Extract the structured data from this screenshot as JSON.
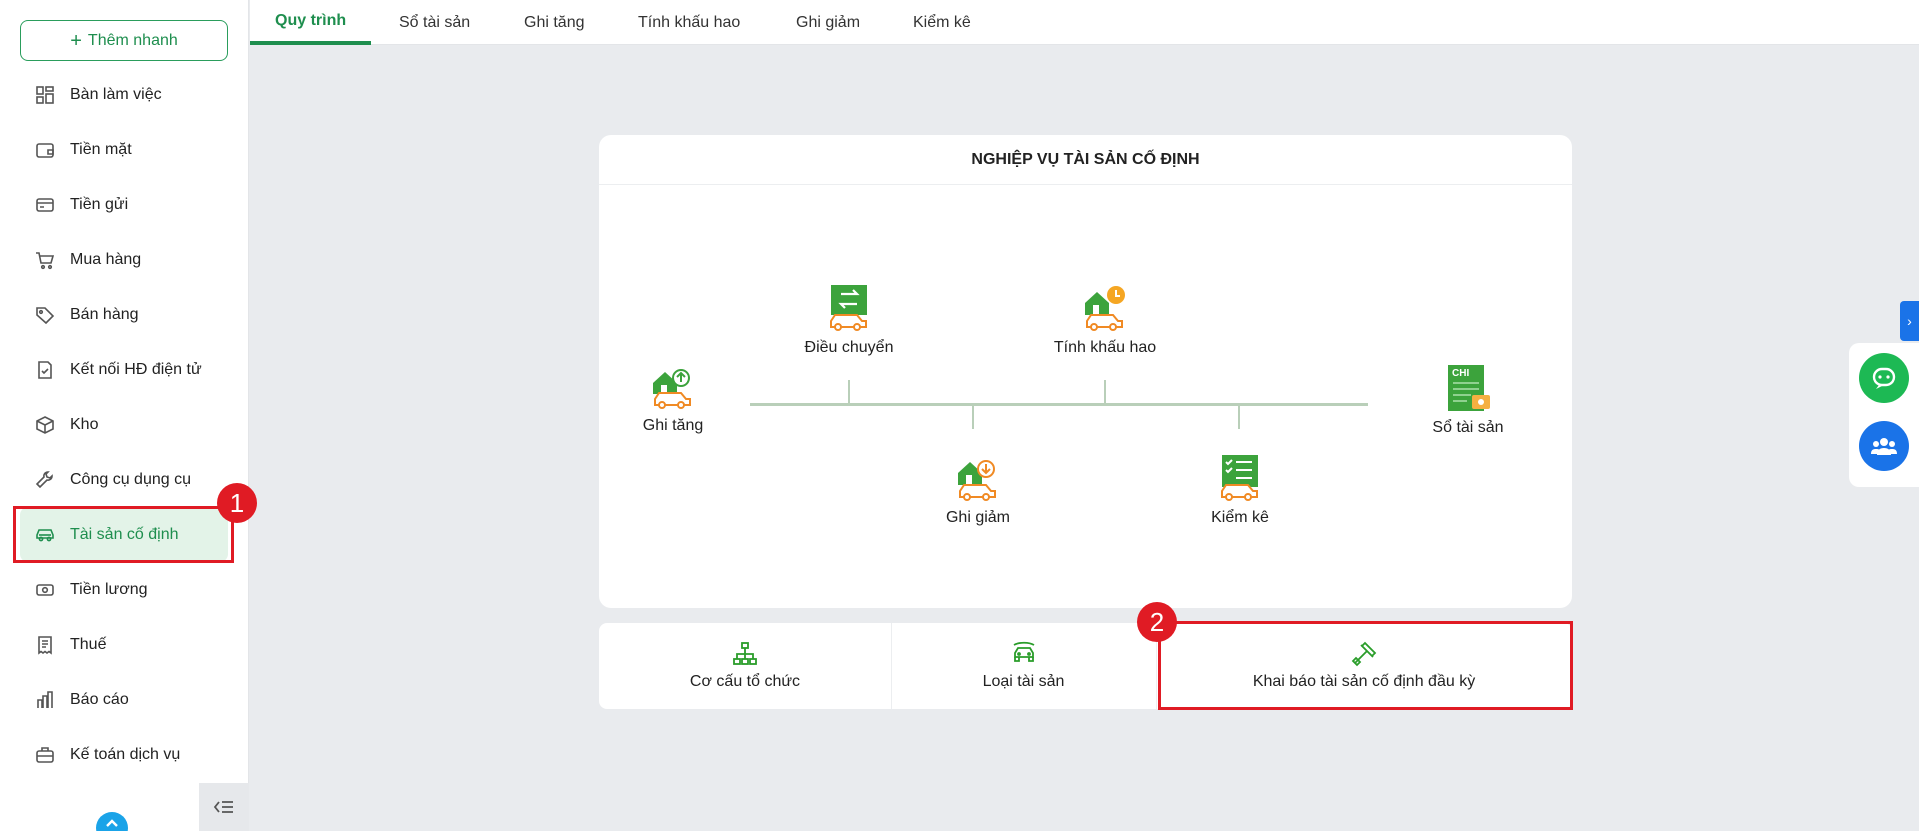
{
  "sidebar": {
    "quick_add_label": "Thêm nhanh",
    "items": [
      {
        "label": "Bàn làm việc",
        "icon": "dashboard-icon"
      },
      {
        "label": "Tiền mặt",
        "icon": "wallet-icon"
      },
      {
        "label": "Tiền gửi",
        "icon": "card-icon"
      },
      {
        "label": "Mua hàng",
        "icon": "cart-icon"
      },
      {
        "label": "Bán hàng",
        "icon": "tag-icon"
      },
      {
        "label": "Kết nối HĐ điện tử",
        "icon": "invoice-icon"
      },
      {
        "label": "Kho",
        "icon": "box-icon"
      },
      {
        "label": "Công cụ dụng cụ",
        "icon": "wrench-icon"
      },
      {
        "label": "Tài sản cố định",
        "icon": "car-icon",
        "active": true
      },
      {
        "label": "Tiền lương",
        "icon": "money-icon"
      },
      {
        "label": "Thuế",
        "icon": "receipt-icon"
      },
      {
        "label": "Báo cáo",
        "icon": "chart-icon"
      },
      {
        "label": "Kế toán dịch vụ",
        "icon": "briefcase-icon"
      }
    ]
  },
  "tabs": [
    "Quy trình",
    "Sổ tài sản",
    "Ghi tăng",
    "Tính khấu hao",
    "Ghi giảm",
    "Kiểm kê"
  ],
  "active_tab": "Quy trình",
  "process": {
    "title": "NGHIỆP VỤ TÀI SẢN CỐ ĐỊNH",
    "nodes": {
      "ghi_tang": "Ghi tăng",
      "dieu_chuyen": "Điều chuyển",
      "ghi_giam": "Ghi giảm",
      "tinh_khau_hao": "Tính khấu hao",
      "kiem_ke": "Kiểm kê",
      "so_tai_san": "Sổ tài sản"
    },
    "ledger_icon_text": "CHI"
  },
  "quick_links": {
    "org": "Cơ cấu tổ chức",
    "asset_type": "Loại tài sản",
    "opening": "Khai báo tài sản cố định đầu kỳ"
  },
  "annotations": {
    "badge_1": "1",
    "badge_2": "2"
  },
  "colors": {
    "brand": "#1e8e4e",
    "highlight": "#e01b24",
    "accent_orange": "#f39c12",
    "chat_green": "#1db954",
    "group_blue": "#1a73e8"
  }
}
